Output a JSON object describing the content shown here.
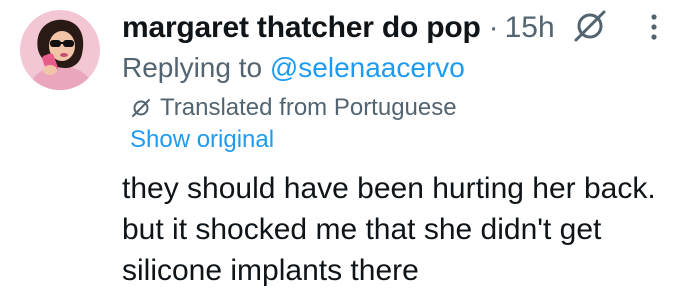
{
  "tweet": {
    "display_name": "margaret thatcher do pop",
    "separator": "·",
    "time": "15h",
    "reply_prefix": "Replying to ",
    "reply_handle": "@selenaacervo",
    "translated_label": "Translated from Portuguese",
    "show_original_label": "Show original",
    "text_lines": [
      "they should have been hurting her back.",
      "but it shocked me that she didn't get",
      "silicone implants there"
    ]
  },
  "icons": {
    "grok": "grok-icon",
    "more": "more-options-icon",
    "translate": "grok-icon"
  },
  "colors": {
    "text": "#0f1419",
    "secondary": "#536471",
    "link": "#1d9bf0",
    "avatar_bg": "#f3c6d3"
  }
}
